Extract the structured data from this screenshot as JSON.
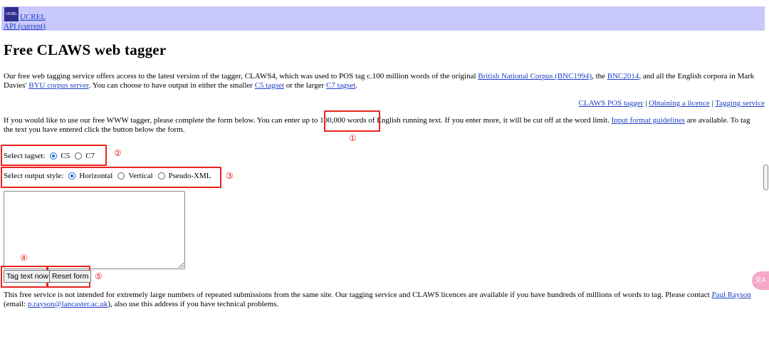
{
  "header": {
    "logo_text": "UCREL",
    "ucrel_link": "UCREL",
    "api_link": "API (current)"
  },
  "page": {
    "title": "Free CLAWS web tagger",
    "intro": {
      "t1": "Our free web tagging service offers access to the latest version of the tagger, CLAWS4, which was used to POS tag c.100 million words of the original ",
      "link_bnc1994": "British National Corpus (BNC1994)",
      "t2": ", the ",
      "link_bnc2014": "BNC2014",
      "t3": ", and all the English corpora in Mark Davies' ",
      "link_byu": "BYU corpus server",
      "t4": ". You can choose to have output in either the smaller ",
      "link_c5": "C5 tagset",
      "t5": " or the larger ",
      "link_c7": "C7 tagset",
      "t6": "."
    },
    "right_links": {
      "pos_tagger": "CLAWS POS tagger",
      "sep": " | ",
      "licence": "Obtaining a licence",
      "service": "Tagging service"
    },
    "instructions": {
      "t1": "If you would like to use our free WWW tagger, please complete the form below. You can enter up to ",
      "limit": "100,000 words",
      "t2": " of English running text. If you enter more, it will be cut off at the word limit. ",
      "link_guidelines": "Input format guidelines",
      "t3": " are available. To tag the text you have entered click the button below the form."
    }
  },
  "form": {
    "tagset_label": "Select tagset:",
    "tagset_options": [
      "C5",
      "C7"
    ],
    "tagset_selected": "C5",
    "style_label": "Select output style:",
    "style_options": [
      "Horizontal",
      "Vertical",
      "Pseudo-XML"
    ],
    "style_selected": "Horizontal",
    "text_value": "",
    "submit_label": "Tag text now",
    "reset_label": "Reset form"
  },
  "footer": {
    "t1": "This free service is not intended for extremely large numbers of repeated submissions from the same site. Our tagging service and CLAWS licences are available if you have hundreds of millions of words to tag. Please contact ",
    "link_contact": "Paul Rayson",
    "t2": " (email: ",
    "link_email": "p.rayson@lancaster.ac.uk",
    "t3": "), also use this address if you have technical problems."
  },
  "annotations": [
    "①",
    "②",
    "③",
    "④",
    "⑤"
  ],
  "colors": {
    "header_bg": "#c8c8fb",
    "annotation_red": "#e8231e",
    "link": "#1e40c8"
  },
  "icons": {
    "floating": "translate-icon"
  }
}
